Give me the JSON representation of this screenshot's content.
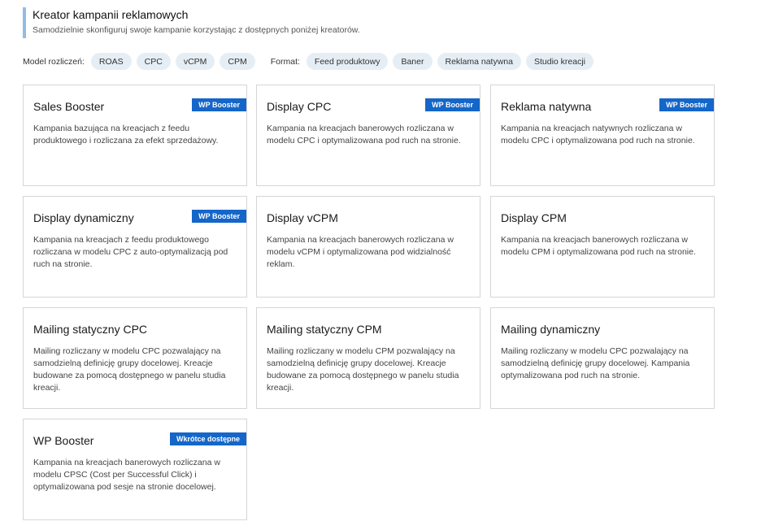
{
  "header": {
    "title": "Kreator kampanii reklamowych",
    "subtitle": "Samodzielnie skonfiguruj swoje kampanie korzystając z dostępnych poniżej kreatorów."
  },
  "filters": {
    "billing_label": "Model rozliczeń:",
    "billing_options": [
      "ROAS",
      "CPC",
      "vCPM",
      "CPM"
    ],
    "format_label": "Format:",
    "format_options": [
      "Feed produktowy",
      "Baner",
      "Reklama natywna",
      "Studio kreacji"
    ]
  },
  "cards": [
    {
      "title": "Sales Booster",
      "badge": "WP Booster",
      "desc": "Kampania bazująca na kreacjach z feedu produktowego i rozliczana za efekt sprzedażowy."
    },
    {
      "title": "Display CPC",
      "badge": "WP Booster",
      "desc": "Kampania na kreacjach banerowych rozliczana w modelu CPC i optymalizowana pod ruch na stronie."
    },
    {
      "title": "Reklama natywna",
      "badge": "WP Booster",
      "desc": "Kampania na kreacjach natywnych rozliczana w modelu CPC i optymalizowana pod ruch na stronie."
    },
    {
      "title": "Display dynamiczny",
      "badge": "WP Booster",
      "desc": "Kampania na kreacjach z feedu produktowego rozliczana w modelu CPC z auto-optymalizacją pod ruch na stronie."
    },
    {
      "title": "Display vCPM",
      "badge": "",
      "desc": "Kampania na kreacjach banerowych rozliczana w modelu vCPM i optymalizowana pod widzialność reklam."
    },
    {
      "title": "Display CPM",
      "badge": "",
      "desc": "Kampania na kreacjach banerowych rozliczana w modelu CPM i optymalizowana pod ruch na stronie."
    },
    {
      "title": "Mailing statyczny CPC",
      "badge": "",
      "desc": "Mailing rozliczany w modelu CPC pozwalający na samodzielną definicję grupy docelowej. Kreacje budowane za pomocą dostępnego w panelu studia kreacji."
    },
    {
      "title": "Mailing statyczny CPM",
      "badge": "",
      "desc": "Mailing rozliczany w modelu CPM pozwalający na samodzielną definicję grupy docelowej. Kreacje budowane za pomocą dostępnego w panelu studia kreacji."
    },
    {
      "title": "Mailing dynamiczny",
      "badge": "",
      "desc": "Mailing rozliczany w modelu CPC pozwalający na samodzielną definicję grupy docelowej. Kampania optymalizowana pod ruch na stronie."
    },
    {
      "title": "WP Booster",
      "badge": "Wkrótce dostępne",
      "desc": "Kampania na kreacjach banerowych rozliczana w modelu CPSC (Cost per Successful Click) i optymalizowana pod sesje na stronie docelowej."
    }
  ],
  "colors": {
    "accent": "#1466c9",
    "header_bar": "#8fbde8",
    "chip_bg": "#e6eef5"
  }
}
